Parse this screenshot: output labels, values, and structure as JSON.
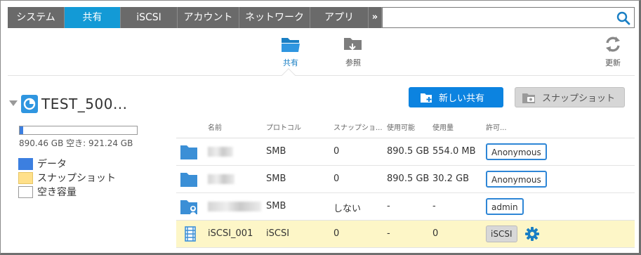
{
  "nav": {
    "items": [
      "システム",
      "共有",
      "iSCSI",
      "アカウント",
      "ネットワーク",
      "アプリ"
    ],
    "active_index": 1,
    "more_label": "»",
    "search_value": "",
    "search_placeholder": ""
  },
  "toolbar": {
    "share_label": "共有",
    "browse_label": "参照",
    "refresh_label": "更新"
  },
  "volume": {
    "name": "TEST_500...",
    "usage_text": "890.46 GB 空き: 921.24 GB",
    "used_fraction": 0.03,
    "legend": [
      {
        "label": "データ",
        "color": "#3c7fe0"
      },
      {
        "label": "スナップショット",
        "color": "#ffe08a"
      },
      {
        "label": "空き容量",
        "color": "#ffffff"
      }
    ]
  },
  "actions": {
    "new_share_label": "新しい共有",
    "snapshot_label": "スナップショット"
  },
  "table": {
    "headers": {
      "name": "名前",
      "protocol": "プロトコル",
      "snapshot": "スナップショ...",
      "available": "使用可能",
      "used": "使用量",
      "permission": "許可..."
    },
    "rows": [
      {
        "name": "",
        "protocol": "SMB",
        "snapshot": "0",
        "available": "890.5 GB",
        "used": "554.0 MB",
        "permission": "Anonymous"
      },
      {
        "name": "",
        "protocol": "SMB",
        "snapshot": "0",
        "available": "890.5 GB",
        "used": "30.2 GB",
        "permission": "Anonymous"
      },
      {
        "name": "",
        "protocol": "SMB",
        "snapshot": "しない",
        "available": "-",
        "used": "-",
        "permission": "admin"
      },
      {
        "name": "iSCSI_001",
        "protocol": "iSCSI",
        "snapshot": "0",
        "available": "-",
        "used": "0",
        "permission": "iSCSI"
      }
    ]
  },
  "colors": {
    "accent": "#139ad6",
    "button_blue": "#0c83e0",
    "highlight_row": "#fdf6c7"
  }
}
